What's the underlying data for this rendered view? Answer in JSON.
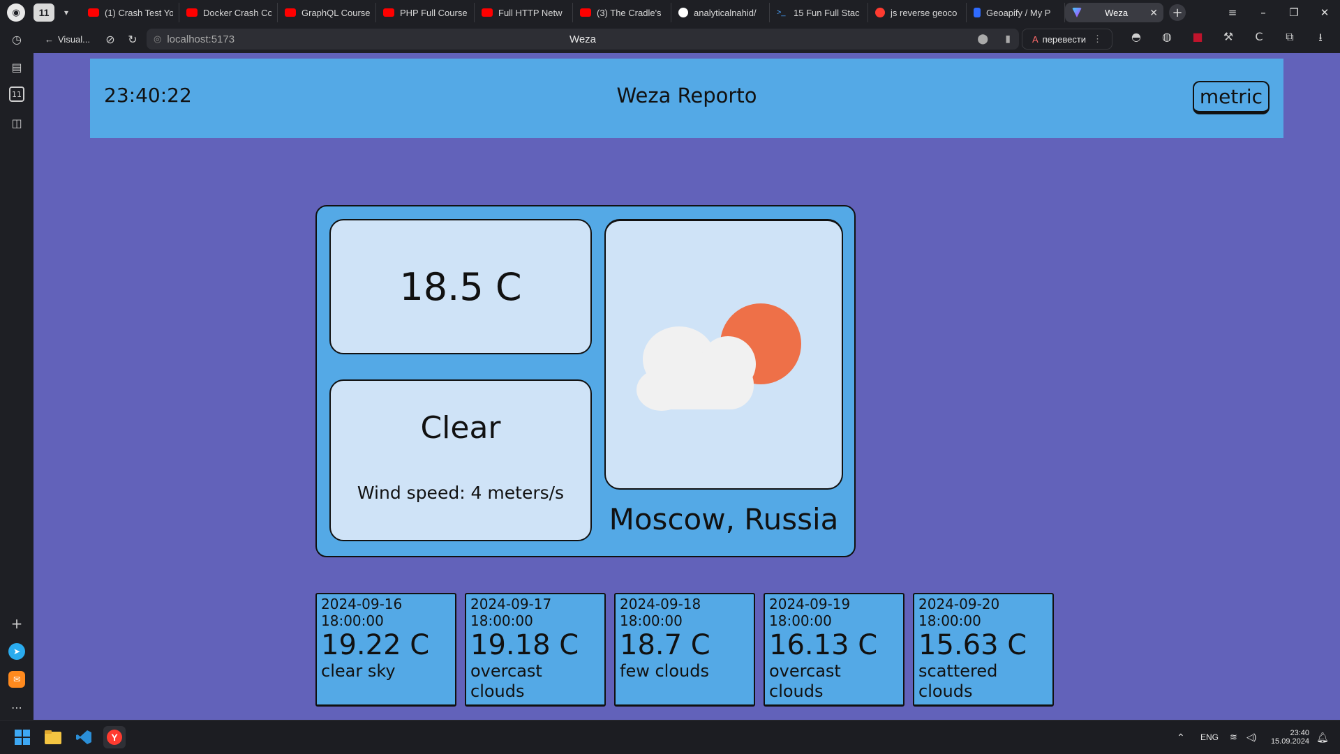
{
  "browser": {
    "tab_count": "11",
    "tabs": [
      {
        "label": "(1) Crash Test Yo",
        "icon": "youtube-icon",
        "color": "#ff0000"
      },
      {
        "label": "Docker Crash Co",
        "icon": "youtube-icon",
        "color": "#ff0000"
      },
      {
        "label": "GraphQL Course",
        "icon": "youtube-icon",
        "color": "#ff0000"
      },
      {
        "label": "PHP Full Course",
        "icon": "youtube-icon",
        "color": "#ff0000"
      },
      {
        "label": "Full HTTP Netw",
        "icon": "youtube-icon",
        "color": "#ff0000"
      },
      {
        "label": "(3) The Cradle's",
        "icon": "youtube-icon",
        "color": "#ff0000"
      },
      {
        "label": "analyticalnahid/",
        "icon": "github-icon",
        "color": "#ffffff"
      },
      {
        "label": "15 Fun Full Stac",
        "icon": "terminal-icon",
        "color": "#4aa3ff"
      },
      {
        "label": "js reverse geoco",
        "icon": "yandex-icon",
        "color": "#ff3b30"
      },
      {
        "label": "Geoapify / My P",
        "icon": "geoapify-icon",
        "color": "#2f6bff"
      }
    ],
    "active_tab": "Weza",
    "back_label": "Visual...",
    "url": "localhost:5173",
    "page_title": "Weza",
    "translate_label": "перевести"
  },
  "header": {
    "time": "23:40:22",
    "title": "Weza Reporto",
    "unit_button": "metric"
  },
  "current": {
    "temperature": "18.5 C",
    "condition": "Clear",
    "wind": "Wind speed: 4 meters/s",
    "location": "Moscow, Russia",
    "icon": "partly-cloudy-icon"
  },
  "forecast": [
    {
      "date": "2024-09-16",
      "time": "18:00:00",
      "temp": "19.22 C",
      "desc": "clear sky"
    },
    {
      "date": "2024-09-17",
      "time": "18:00:00",
      "temp": "19.18 C",
      "desc": "overcast clouds"
    },
    {
      "date": "2024-09-18",
      "time": "18:00:00",
      "temp": "18.7 C",
      "desc": "few clouds"
    },
    {
      "date": "2024-09-19",
      "time": "18:00:00",
      "temp": "16.13 C",
      "desc": "overcast clouds"
    },
    {
      "date": "2024-09-20",
      "time": "18:00:00",
      "temp": "15.63 C",
      "desc": "scattered clouds"
    }
  ],
  "taskbar": {
    "language": "ENG",
    "time": "23:40",
    "date": "15.09.2024"
  },
  "colors": {
    "page_bg": "#6262ba",
    "panel": "#54a9e6",
    "card": "#cfe3f7",
    "sun": "#ee7048",
    "cloud": "#f1f1f1"
  }
}
